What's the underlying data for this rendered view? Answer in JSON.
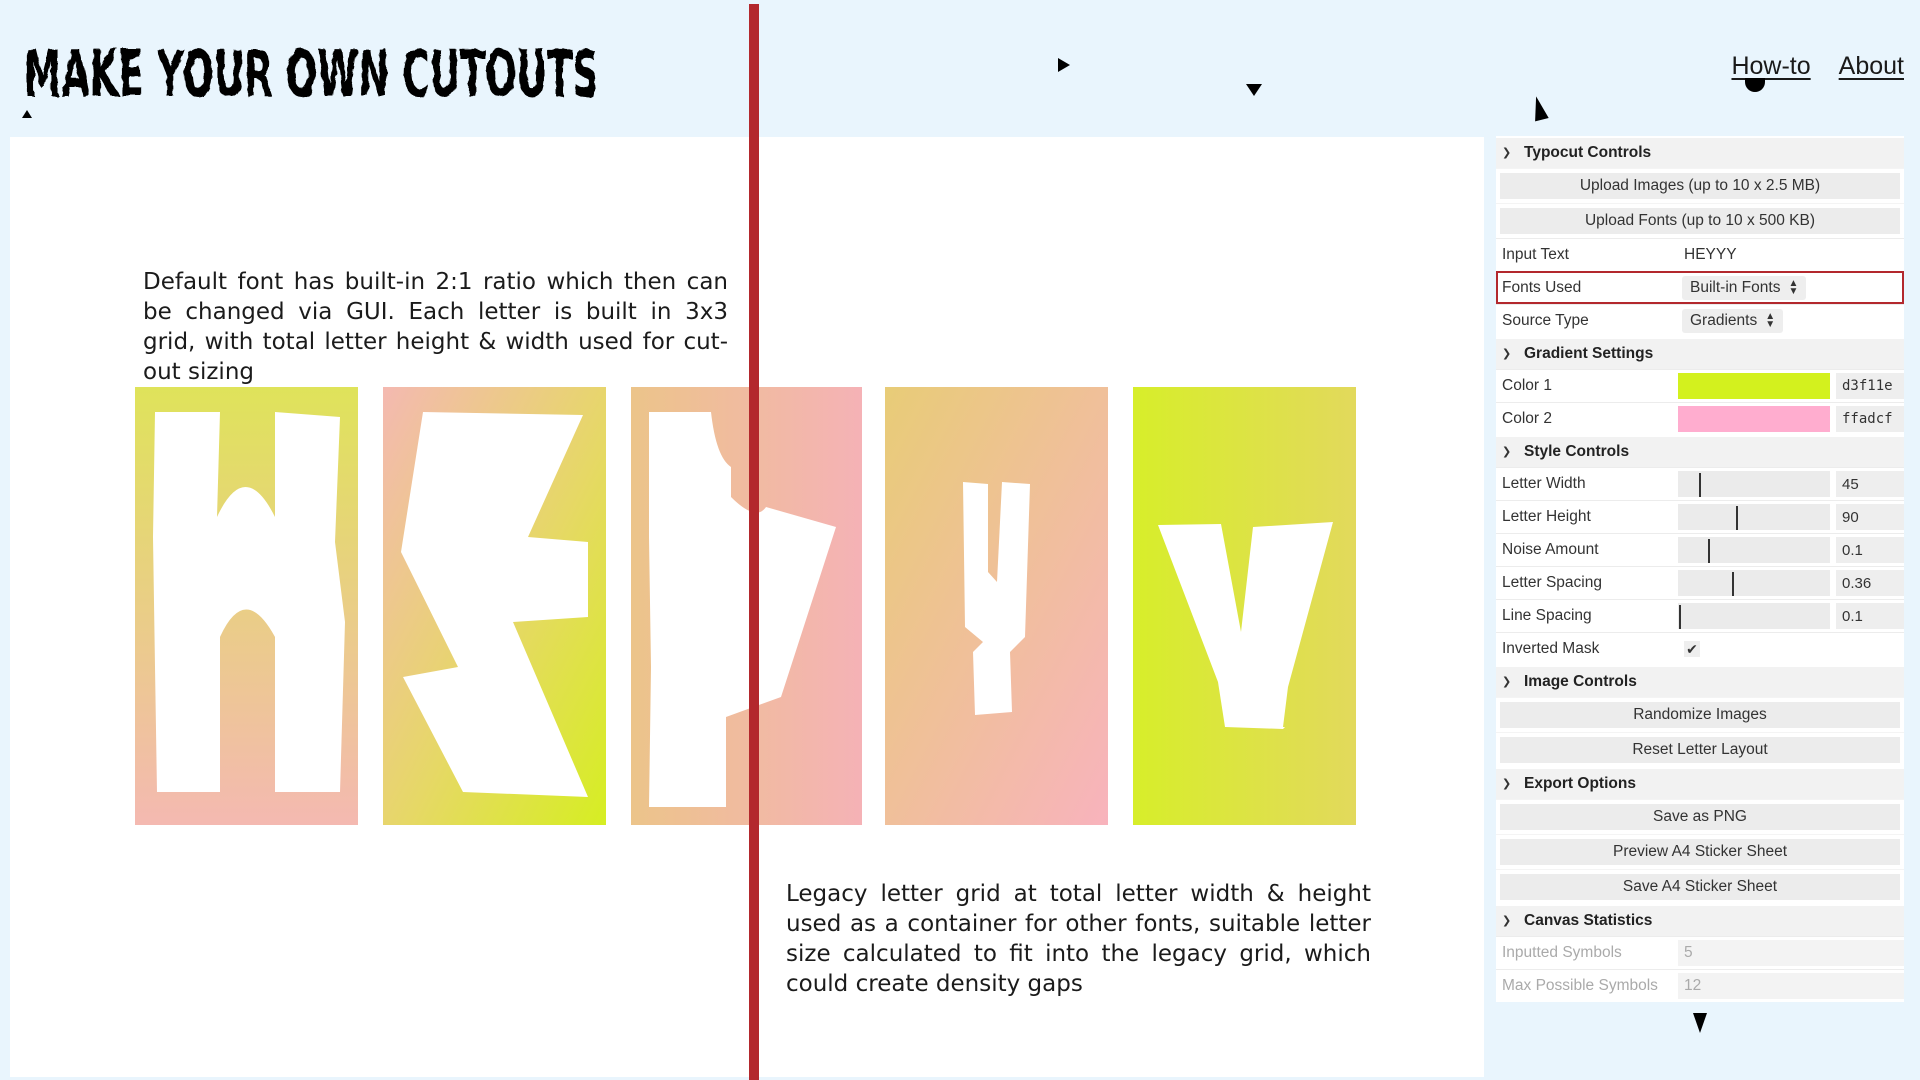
{
  "header": {
    "logo_text": "MAKE YOUR OWN CUTOUTS",
    "nav": {
      "howto": "How-to",
      "about": "About"
    }
  },
  "canvas": {
    "caption_top": "Default font has built-in 2:1 ratio which then can be changed via GUI. Each letter is built in 3x3 grid, with total letter height & width used for cut-out sizing",
    "caption_bottom": "Legacy letter grid at total letter width & height used as a container for other fonts, suitable letter size calculated to fit into the legacy grid, which could create density gaps",
    "letters": [
      "H",
      "E",
      "Y",
      "y",
      "Y"
    ],
    "gradient_colors": [
      "#d3f11e",
      "#ffadcf"
    ]
  },
  "gui": {
    "typocut": {
      "title": "Typocut Controls",
      "upload_images": "Upload Images (up to 10 x 2.5 MB)",
      "upload_fonts": "Upload Fonts (up to 10 x 500 KB)",
      "input_text_label": "Input Text",
      "input_text_value": "HEYYY",
      "fonts_used_label": "Fonts Used",
      "fonts_used_value": "Built-in Fonts",
      "source_type_label": "Source Type",
      "source_type_value": "Gradients"
    },
    "gradient": {
      "title": "Gradient Settings",
      "color1_label": "Color 1",
      "color1_hex": "d3f11e",
      "color1_swatch": "#d3f11e",
      "color2_label": "Color 2",
      "color2_hex": "ffadcf",
      "color2_swatch": "#ffadcf"
    },
    "style": {
      "title": "Style Controls",
      "letter_width_label": "Letter Width",
      "letter_width": "45",
      "letter_height_label": "Letter Height",
      "letter_height": "90",
      "noise_label": "Noise Amount",
      "noise": "0.1",
      "spacing_label": "Letter Spacing",
      "spacing": "0.36",
      "line_spacing_label": "Line Spacing",
      "line_spacing": "0.1",
      "inverted_label": "Inverted Mask",
      "inverted_checked": true
    },
    "image": {
      "title": "Image Controls",
      "randomize": "Randomize Images",
      "reset": "Reset Letter Layout"
    },
    "export": {
      "title": "Export Options",
      "save_png": "Save as PNG",
      "preview_a4": "Preview A4 Sticker Sheet",
      "save_a4": "Save A4 Sticker Sheet"
    },
    "stats": {
      "title": "Canvas Statistics",
      "inputted_label": "Inputted Symbols",
      "inputted": "5",
      "max_label": "Max Possible Symbols",
      "max": "12"
    }
  }
}
